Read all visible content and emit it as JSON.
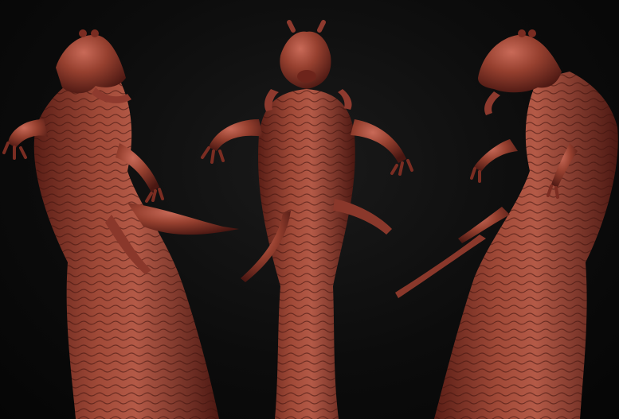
{
  "scene": {
    "background_color": "#0a0a0a",
    "clay_color": "#8e3a2e",
    "clay_highlight": "#c96a58",
    "clay_shadow": "#4a1712",
    "views": [
      {
        "name": "left-three-quarter-view"
      },
      {
        "name": "front-view"
      },
      {
        "name": "right-three-quarter-view"
      }
    ]
  }
}
